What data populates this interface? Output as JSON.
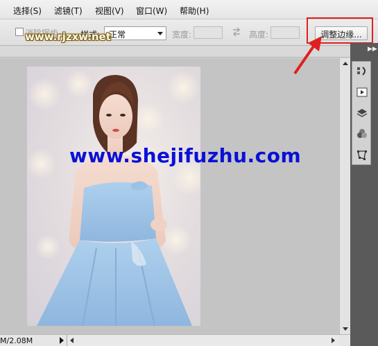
{
  "menubar": {
    "items": [
      {
        "label": "选择(S)"
      },
      {
        "label": "滤镜(T)"
      },
      {
        "label": "视图(V)"
      },
      {
        "label": "窗口(W)"
      },
      {
        "label": "帮助(H)"
      }
    ]
  },
  "options": {
    "antialias_label": "消除锯齿",
    "style_label": "样式:",
    "style_value": "正常",
    "width_label": "宽度:",
    "height_label": "高度:",
    "refine_edge_label": "调整边缘..."
  },
  "watermarks": {
    "top": "www.rjzxw.net",
    "center": "www.shejifuzhu.com"
  },
  "status": {
    "doc_size": "M/2.08M"
  },
  "colors": {
    "highlight": "#e02020",
    "watermark_center": "#0a10d6",
    "dock_bg": "#5a5a5a"
  },
  "icons": [
    "swap-icon",
    "history-icon",
    "play-icon",
    "layers-icon",
    "channels-icon",
    "paths-icon",
    "collapse-icon"
  ]
}
